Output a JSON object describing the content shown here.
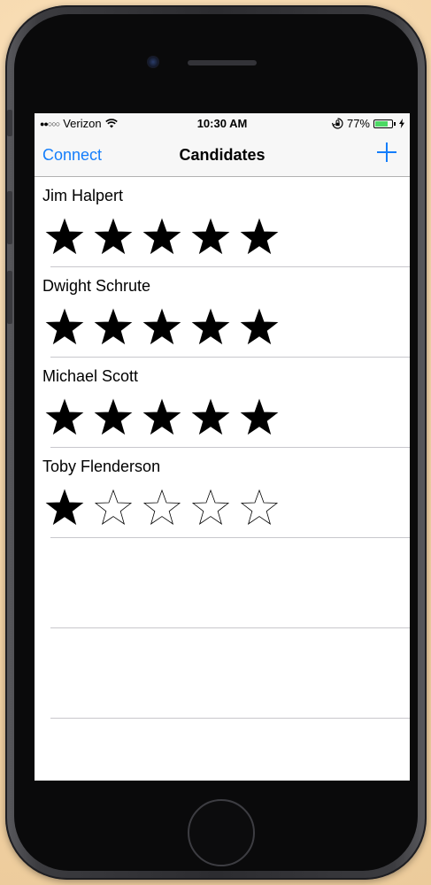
{
  "status_bar": {
    "carrier": "Verizon",
    "signal_icon": "signal-dots-icon",
    "wifi_icon": "wifi-icon",
    "time": "10:30 AM",
    "lock_icon": "orientation-lock-icon",
    "battery_percent": "77%",
    "battery_level": 0.77,
    "battery_color": "#4cd964",
    "charging_icon": "charging-bolt-icon"
  },
  "nav": {
    "left_button": "Connect",
    "title": "Candidates",
    "right_icon": "plus-icon",
    "accent_color": "#147efb"
  },
  "candidates": [
    {
      "name": "Jim Halpert",
      "rating": 5,
      "max_rating": 5
    },
    {
      "name": "Dwight Schrute",
      "rating": 5,
      "max_rating": 5
    },
    {
      "name": "Michael Scott",
      "rating": 5,
      "max_rating": 5
    },
    {
      "name": "Toby Flenderson",
      "rating": 1,
      "max_rating": 5
    }
  ],
  "empty_rows": 2
}
